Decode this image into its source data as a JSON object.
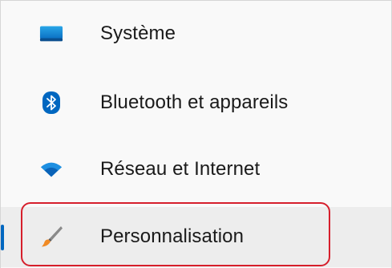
{
  "nav": {
    "items": [
      {
        "label": "Système",
        "icon": "monitor-icon"
      },
      {
        "label": "Bluetooth et appareils",
        "icon": "bluetooth-icon"
      },
      {
        "label": "Réseau et Internet",
        "icon": "wifi-icon"
      },
      {
        "label": "Personnalisation",
        "icon": "paintbrush-icon",
        "selected": true
      }
    ]
  },
  "colors": {
    "accent": "#0067c0",
    "highlight_border": "#d61f2c",
    "selected_background": "#ededed",
    "pane_background": "#f9f9f9"
  }
}
